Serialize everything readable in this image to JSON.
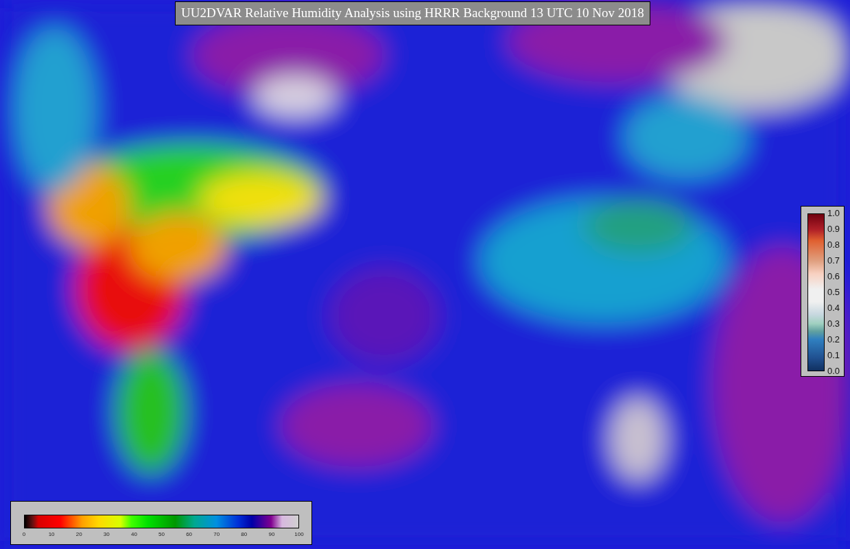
{
  "title": "UU2DVAR Relative Humidity Analysis using HRRR Background 13 UTC 10 Nov 2018",
  "humidity_colorbar": {
    "ticks": [
      "0",
      "10",
      "20",
      "30",
      "40",
      "50",
      "60",
      "70",
      "80",
      "90",
      "100"
    ]
  },
  "error_colorbar": {
    "ticks": [
      "1.0",
      "0.9",
      "0.8",
      "0.7",
      "0.6",
      "0.5",
      "0.4",
      "0.3",
      "0.2",
      "0.1",
      "0.0"
    ]
  }
}
